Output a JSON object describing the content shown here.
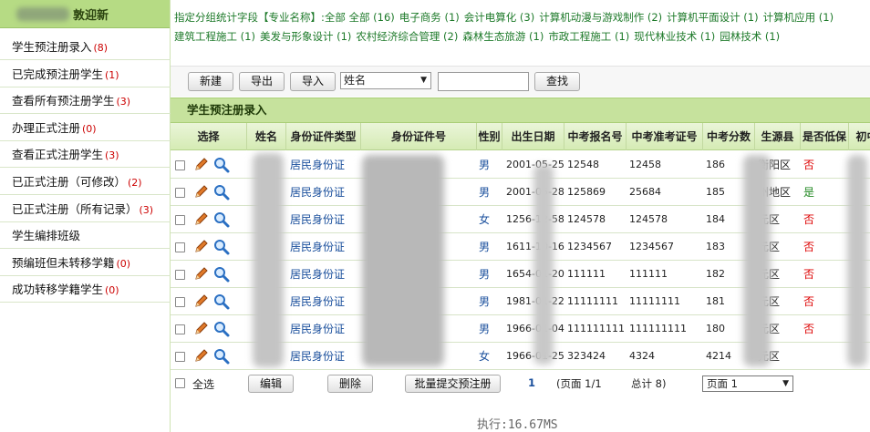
{
  "sidebar": {
    "header": "敦迎新",
    "items": [
      {
        "label": "学生预注册录入",
        "count": "(8)"
      },
      {
        "label": "已完成预注册学生",
        "count": "(1)"
      },
      {
        "label": "查看所有预注册学生",
        "count": "(3)"
      },
      {
        "label": "办理正式注册",
        "count": "(0)"
      },
      {
        "label": "查看正式注册学生",
        "count": "(3)"
      },
      {
        "label": "已正式注册（可修改）",
        "count": "(2)"
      },
      {
        "label": "已正式注册（所有记录）",
        "count": "(3)"
      },
      {
        "label": "学生编排班级",
        "count": ""
      },
      {
        "label": "预编班但未转移学籍",
        "count": "(0)"
      },
      {
        "label": "成功转移学籍学生",
        "count": "(0)"
      }
    ]
  },
  "filter": {
    "prefix": "指定分组统计字段【专业名称】:全部",
    "links_line1": [
      "全部 (16)",
      "电子商务 (1)",
      "会计电算化 (3)",
      "计算机动漫与游戏制作 (2)",
      "计算机平面设计 (1)",
      "计算机应用 (1)"
    ],
    "links_line2": [
      "建筑工程施工 (1)",
      "美发与形象设计 (1)",
      "农村经济综合管理 (2)",
      "森林生态旅游 (1)",
      "市政工程施工 (1)",
      "现代林业技术 (1)",
      "园林技术 (1)"
    ]
  },
  "toolbar": {
    "new": "新建",
    "export": "导出",
    "import": "导入",
    "field_select": "姓名",
    "search_value": "",
    "search": "查找"
  },
  "table": {
    "title": "学生预注册录入",
    "columns": [
      "选择",
      "姓名",
      "身份证件类型",
      "身份证件号",
      "性别",
      "出生日期",
      "中考报名号",
      "中考准考证号",
      "中考分数",
      "生源县",
      "是否低保",
      "初中"
    ],
    "rows": [
      {
        "id_type": "居民身份证",
        "gender": "男",
        "birth": "2001-05-25",
        "reg_no": "12548",
        "exam_no": "12458",
        "score": "186",
        "county": "衡阳区",
        "low": "否"
      },
      {
        "id_type": "居民身份证",
        "gender": "男",
        "birth": "2001-05-28",
        "reg_no": "125869",
        "exam_no": "25684",
        "score": "185",
        "county": "州地区",
        "low": "是"
      },
      {
        "id_type": "居民身份证",
        "gender": "女",
        "birth": "1256-12-58",
        "reg_no": "124578",
        "exam_no": "124578",
        "score": "184",
        "county": "元区",
        "low": "否"
      },
      {
        "id_type": "居民身份证",
        "gender": "男",
        "birth": "1611-10-16",
        "reg_no": "1234567",
        "exam_no": "1234567",
        "score": "183",
        "county": "元区",
        "low": "否"
      },
      {
        "id_type": "居民身份证",
        "gender": "男",
        "birth": "1654-01-20",
        "reg_no": "111111",
        "exam_no": "111111",
        "score": "182",
        "county": "元区",
        "low": "否"
      },
      {
        "id_type": "居民身份证",
        "gender": "男",
        "birth": "1981-01-22",
        "reg_no": "11111111",
        "exam_no": "11111111",
        "score": "181",
        "county": "元区",
        "low": "否"
      },
      {
        "id_type": "居民身份证",
        "gender": "男",
        "birth": "1966-01-04",
        "reg_no": "111111111",
        "exam_no": "111111111",
        "score": "180",
        "county": "元区",
        "low": "否"
      },
      {
        "id_type": "居民身份证",
        "gender": "女",
        "birth": "1966-01-25",
        "reg_no": "323424",
        "exam_no": "4324",
        "score": "4214",
        "county": "元区",
        "low": ""
      }
    ]
  },
  "footer": {
    "select_all": "全选",
    "edit": "编辑",
    "delete": "删除",
    "batch_submit": "批量提交预注册",
    "page_num": "1",
    "page_info": "(页面  1/1",
    "total": "总计  8)",
    "page_select": "页面 1"
  },
  "status": "执行:16.67MS"
}
